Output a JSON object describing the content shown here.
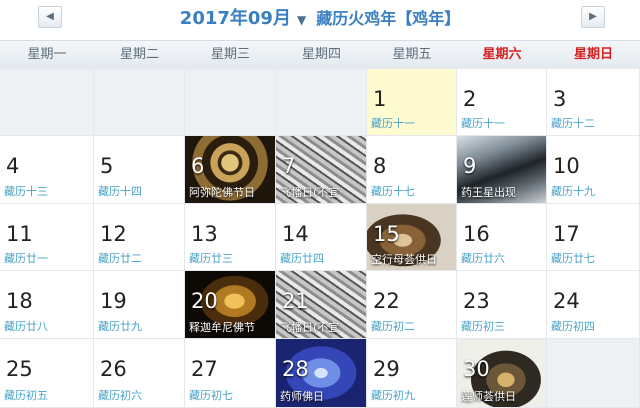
{
  "header": {
    "prev_icon": "◀",
    "next_icon": "▶",
    "year_month": "2017年09月",
    "dropdown_icon": "▼",
    "lunar_year": "藏历火鸡年【鸡年】"
  },
  "weekdays": [
    {
      "label": "星期一",
      "weekend": false
    },
    {
      "label": "星期二",
      "weekend": false
    },
    {
      "label": "星期三",
      "weekend": false
    },
    {
      "label": "星期四",
      "weekend": false
    },
    {
      "label": "星期五",
      "weekend": false
    },
    {
      "label": "星期六",
      "weekend": true
    },
    {
      "label": "星期日",
      "weekend": true
    }
  ],
  "days": [
    {
      "day": "",
      "sub": ""
    },
    {
      "day": "",
      "sub": ""
    },
    {
      "day": "",
      "sub": ""
    },
    {
      "day": "",
      "sub": ""
    },
    {
      "day": "1",
      "sub": "藏历十一",
      "today": true
    },
    {
      "day": "2",
      "sub": "藏历十一"
    },
    {
      "day": "3",
      "sub": "藏历十二"
    },
    {
      "day": "4",
      "sub": "藏历十三"
    },
    {
      "day": "5",
      "sub": "藏历十四"
    },
    {
      "day": "6",
      "sub": "阿弥陀佛节日",
      "fest": "amitabha"
    },
    {
      "day": "7",
      "sub": "飞幡日(不宜",
      "fest": "flag"
    },
    {
      "day": "8",
      "sub": "藏历十七"
    },
    {
      "day": "9",
      "sub": "药王星出现",
      "fest": "water"
    },
    {
      "day": "10",
      "sub": "藏历十九"
    },
    {
      "day": "11",
      "sub": "藏历廿一"
    },
    {
      "day": "12",
      "sub": "藏历廿二"
    },
    {
      "day": "13",
      "sub": "藏历廿三"
    },
    {
      "day": "14",
      "sub": "藏历廿四"
    },
    {
      "day": "15",
      "sub": "空行母荟供日",
      "fest": "dakini"
    },
    {
      "day": "16",
      "sub": "藏历廿六"
    },
    {
      "day": "17",
      "sub": "藏历廿七"
    },
    {
      "day": "18",
      "sub": "藏历廿八"
    },
    {
      "day": "19",
      "sub": "藏历廿九"
    },
    {
      "day": "20",
      "sub": "释迦牟尼佛节",
      "fest": "buddha"
    },
    {
      "day": "21",
      "sub": "飞幡日(不宜",
      "fest": "flag"
    },
    {
      "day": "22",
      "sub": "藏历初二"
    },
    {
      "day": "23",
      "sub": "藏历初三"
    },
    {
      "day": "24",
      "sub": "藏历初四"
    },
    {
      "day": "25",
      "sub": "藏历初五"
    },
    {
      "day": "26",
      "sub": "藏历初六"
    },
    {
      "day": "27",
      "sub": "藏历初七"
    },
    {
      "day": "28",
      "sub": "药师佛日",
      "fest": "medicine"
    },
    {
      "day": "29",
      "sub": "藏历初九"
    },
    {
      "day": "30",
      "sub": "莲师荟供日",
      "fest": "padma"
    },
    {
      "day": "",
      "sub": ""
    }
  ]
}
